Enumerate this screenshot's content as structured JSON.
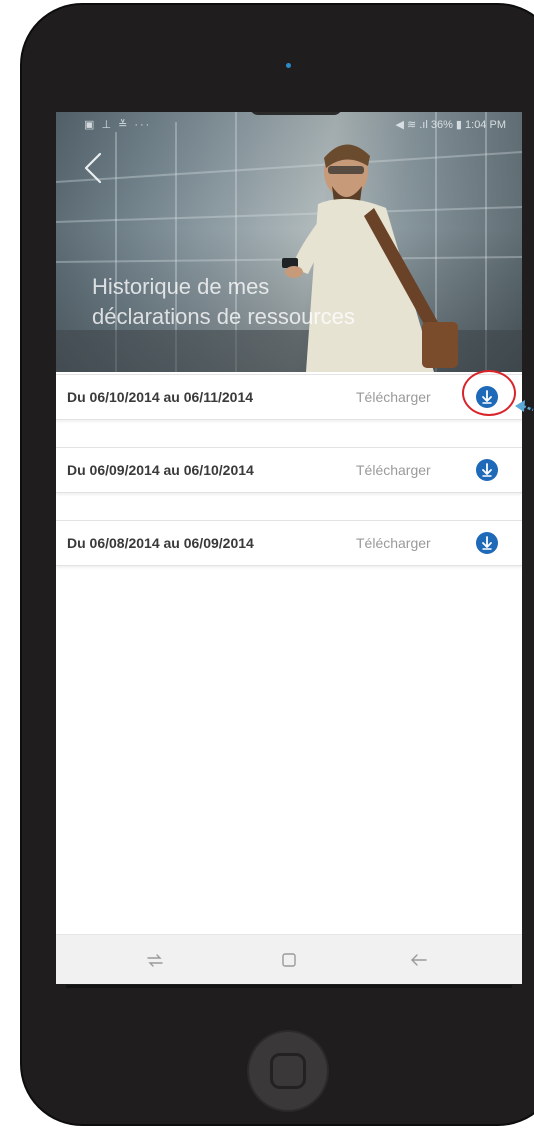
{
  "status_bar": {
    "left_icons": "▣ ⊥ ≚ ···",
    "right_text": "◀ ≋ .ıl 36% ▮ 1:04 PM"
  },
  "header": {
    "back_icon": "chevron-left-icon",
    "title_line1": "Historique de mes",
    "title_line2": "déclarations de ressources"
  },
  "items": [
    {
      "period": "Du 06/10/2014 au 06/11/2014",
      "action": "Télécharger",
      "icon": "download-icon"
    },
    {
      "period": "Du 06/09/2014 au 06/10/2014",
      "action": "Télécharger",
      "icon": "download-icon"
    },
    {
      "period": "Du 06/08/2014 au 06/09/2014",
      "action": "Télécharger",
      "icon": "download-icon"
    }
  ],
  "navbar": {
    "recent_icon": "recent-apps-icon",
    "home_icon": "home-square-icon",
    "back_icon": "back-arrow-icon"
  },
  "colors": {
    "accent": "#1e69b8",
    "highlight": "#d8242a",
    "pointer": "#5aa9d6",
    "phone_body": "#1f1d1e"
  }
}
